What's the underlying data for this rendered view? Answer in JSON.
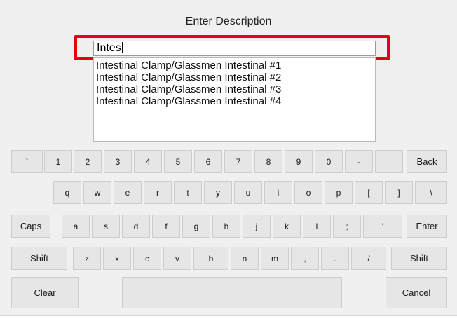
{
  "dialog": {
    "title": "Enter Description",
    "input_value": "Intes"
  },
  "suggestions": [
    "Intestinal Clamp/Glassmen Intestinal #1",
    "Intestinal Clamp/Glassmen Intestinal #2",
    "Intestinal Clamp/Glassmen Intestinal #3",
    "Intestinal Clamp/Glassmen Intestinal #4"
  ],
  "keyboard": {
    "row1": [
      "`",
      "1",
      "2",
      "3",
      "4",
      "5",
      "6",
      "7",
      "8",
      "9",
      "0",
      "-",
      "=",
      "Back"
    ],
    "row2": [
      "q",
      "w",
      "e",
      "r",
      "t",
      "y",
      "u",
      "i",
      "o",
      "p",
      "[",
      "]",
      "\\"
    ],
    "row3": [
      "Caps",
      "a",
      "s",
      "d",
      "f",
      "g",
      "h",
      "j",
      "k",
      "l",
      ";",
      "'",
      "Enter"
    ],
    "row4": [
      "Shift",
      "z",
      "x",
      "c",
      "v",
      "b",
      "n",
      "m",
      ",",
      ".",
      "/",
      "Shift"
    ],
    "row5": [
      "Clear",
      "",
      "Cancel"
    ]
  },
  "colors": {
    "highlight": "#e60012",
    "panel": "#f0f0f0",
    "key": "#e6e6e6"
  }
}
